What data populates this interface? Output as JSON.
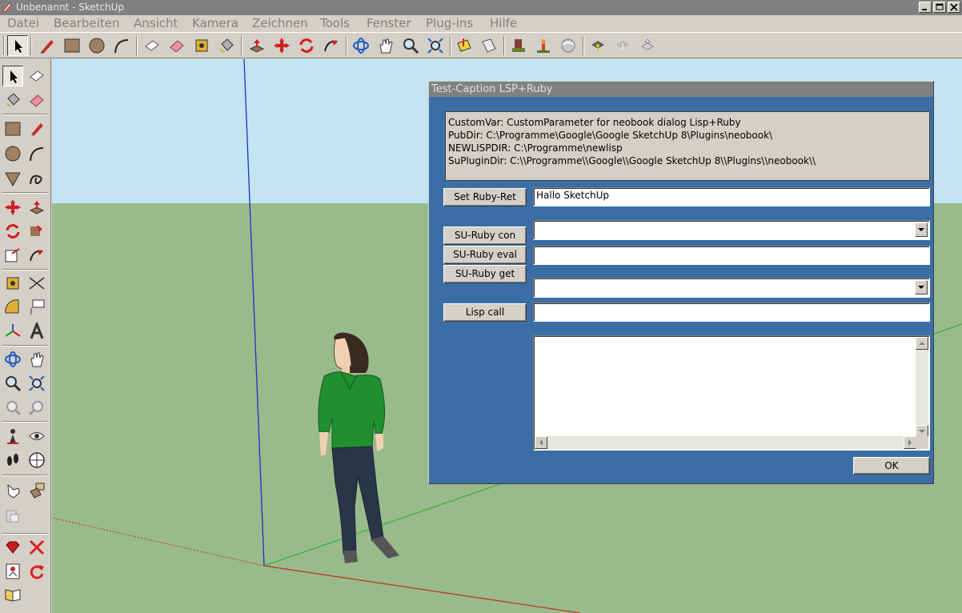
{
  "window": {
    "title": "Unbenannt - SketchUp"
  },
  "menu": [
    "Datei",
    "Bearbeiten",
    "Ansicht",
    "Kamera",
    "Zeichnen",
    "Tools",
    "Fenster",
    "Plug-ins",
    "Hilfe"
  ],
  "toolbar": {
    "tools": [
      "select-icon",
      "pencil-icon",
      "rectangle-icon",
      "circle-icon",
      "arc-icon",
      "eraser-outline-icon",
      "eraser-icon",
      "tape-measure-icon",
      "paint-bucket-icon",
      "push-pull-icon",
      "move-icon",
      "rotate-icon",
      "follow-me-icon",
      "orbit-icon",
      "pan-icon",
      "zoom-icon",
      "zoom-extents-icon",
      "section-plane-icon",
      "section-display-icon",
      "components-icon",
      "warehouse-icon",
      "share-model-icon",
      "get-model-icon",
      "share-component-icon",
      "get-component-icon"
    ]
  },
  "dialog": {
    "title": "Test-Caption LSP+Ruby",
    "info_lines": [
      "CustomVar: CustomParameter for neobook dialog Lisp+Ruby",
      "PubDir: C:\\Programme\\Google\\Google SketchUp 8\\Plugins\\neobook\\",
      "NEWLISPDIR: C:\\Programme\\newlisp",
      "SuPluginDir: C:\\\\Programme\\\\Google\\\\Google SketchUp 8\\\\Plugins\\\\neobook\\\\"
    ],
    "set_ruby_ret_label": "Set Ruby-Ret",
    "ruby_ret_value": "Hallo SketchUp",
    "su_ruby_con_label": "SU-Ruby con",
    "su_ruby_eval_label": "SU-Ruby eval",
    "su_ruby_get_label": "SU-Ruby get",
    "lisp_call_label": "Lisp call",
    "con_value": "",
    "eval_value": "",
    "get_value": "",
    "lisp_value": "",
    "ok_label": "OK"
  },
  "colors": {
    "sky": "#c4e4f4",
    "ground": "#99bb8c",
    "dialog_bg": "#3a6ea5",
    "face": "#d4d0c8"
  }
}
